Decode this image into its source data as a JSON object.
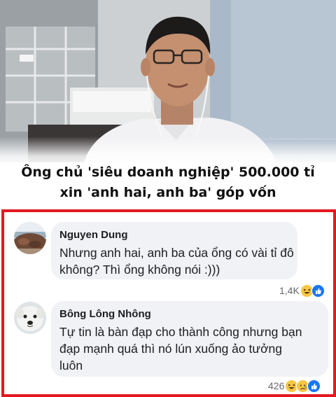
{
  "post": {
    "headline_lines": [
      "Ông chủ 'siêu doanh nghiệp' 500.000 tỉ",
      "xin 'anh hai, anh ba' góp vốn"
    ]
  },
  "comments": [
    {
      "author": "Nguyen Dung",
      "text_lines": [
        "Nhưng anh hai, anh ba của ổng có vài tỉ đô",
        "không? Thì ổng không nói :)))"
      ],
      "reaction_count": "1,4K",
      "reaction_icons": [
        "haha-icon",
        "like-icon"
      ]
    },
    {
      "author": "Bông Lông Nhông",
      "text_lines": [
        "Tự tin là bàn đạp cho thành công nhưng bạn",
        "đạp mạnh quá thì nó lún xuống ảo tưởng",
        "luôn"
      ],
      "reaction_count": "426",
      "reaction_icons": [
        "haha-icon",
        "sad-icon",
        "like-icon"
      ]
    }
  ],
  "colors": {
    "frame_border": "#e4191f",
    "bubble_bg": "#f0f2f5",
    "like_blue": "#1877f2",
    "haha_yellow": "#f7c744"
  }
}
